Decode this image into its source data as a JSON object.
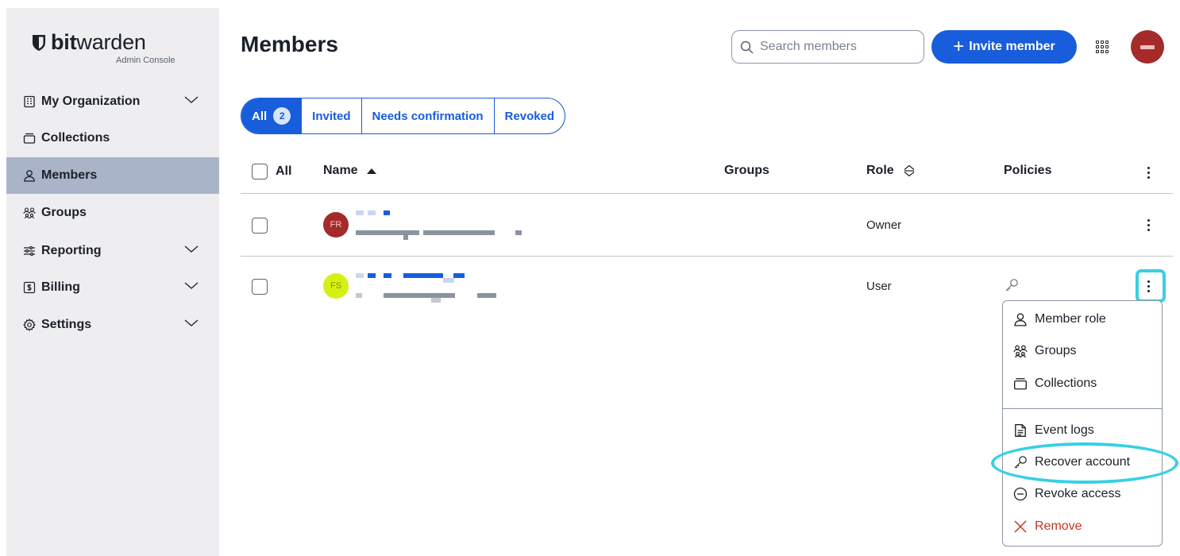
{
  "app": {
    "brand_bold": "bit",
    "brand_light": "warden",
    "subtitle": "Admin Console"
  },
  "sidebar": {
    "items": [
      {
        "label": "My Organization",
        "icon": "organization-icon",
        "has_chevron": true
      },
      {
        "label": "Collections",
        "icon": "collections-icon",
        "has_chevron": false
      },
      {
        "label": "Members",
        "icon": "person-icon",
        "has_chevron": false,
        "active": true
      },
      {
        "label": "Groups",
        "icon": "groups-icon",
        "has_chevron": false
      },
      {
        "label": "Reporting",
        "icon": "sliders-icon",
        "has_chevron": true
      },
      {
        "label": "Billing",
        "icon": "billing-icon",
        "has_chevron": true
      },
      {
        "label": "Settings",
        "icon": "gear-icon",
        "has_chevron": true
      }
    ]
  },
  "header": {
    "title": "Members",
    "search_placeholder": "Search members",
    "invite_label": "Invite member"
  },
  "filters": {
    "tabs": [
      {
        "label": "All",
        "count": "2",
        "active": true
      },
      {
        "label": "Invited"
      },
      {
        "label": "Needs confirmation"
      },
      {
        "label": "Revoked"
      }
    ]
  },
  "table": {
    "columns": {
      "select_all": "All",
      "name": "Name",
      "groups": "Groups",
      "role": "Role",
      "policies": "Policies"
    },
    "rows": [
      {
        "initials": "FR",
        "role": "Owner",
        "avatar_color": "#a52a2a",
        "initials_color": "#f5c6c6",
        "has_key_policy": false
      },
      {
        "initials": "FS",
        "role": "User",
        "avatar_color": "#d6f014",
        "initials_color": "#8a8f12",
        "has_key_policy": true
      }
    ]
  },
  "menu": {
    "items": [
      {
        "label": "Member role",
        "icon": "person-icon"
      },
      {
        "label": "Groups",
        "icon": "groups-icon"
      },
      {
        "label": "Collections",
        "icon": "collections-icon"
      },
      {
        "label": "Event logs",
        "icon": "document-icon"
      },
      {
        "label": "Recover account",
        "icon": "key-icon",
        "highlighted": true
      },
      {
        "label": "Revoke access",
        "icon": "minus-circle-icon"
      },
      {
        "label": "Remove",
        "icon": "close-icon",
        "danger": true
      }
    ]
  },
  "colors": {
    "primary": "#175ddc",
    "sidebar_bg": "#eeeef0",
    "sidebar_active": "#aab4c8",
    "danger": "#c83522",
    "highlight": "#38d0e3"
  }
}
